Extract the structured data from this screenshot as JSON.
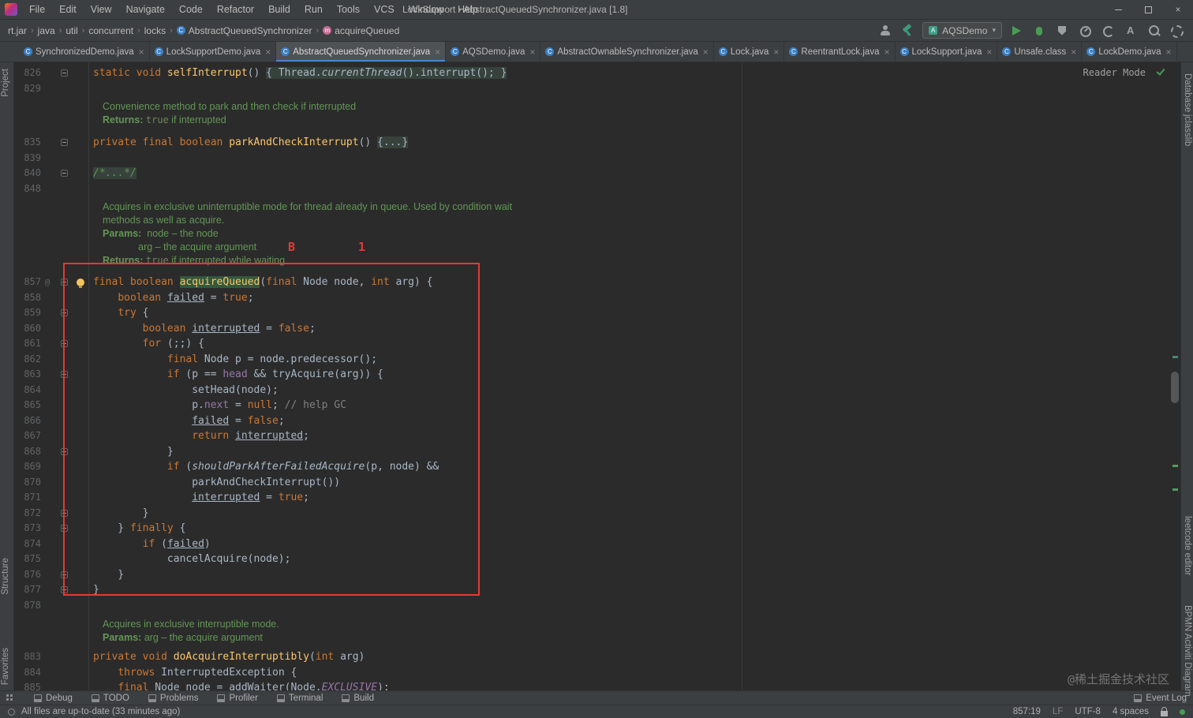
{
  "titlebar": {
    "menus": [
      "File",
      "Edit",
      "View",
      "Navigate",
      "Code",
      "Refactor",
      "Build",
      "Run",
      "Tools",
      "VCS",
      "Window",
      "Help"
    ],
    "title": "LockSupport - AbstractQueuedSynchronizer.java [1.8]"
  },
  "navbar": {
    "breadcrumbs": [
      {
        "label": "rt.jar"
      },
      {
        "label": "java"
      },
      {
        "label": "util"
      },
      {
        "label": "concurrent"
      },
      {
        "label": "locks"
      },
      {
        "label": "AbstractQueuedSynchronizer",
        "icon": "class"
      },
      {
        "label": "acquireQueued",
        "icon": "method"
      }
    ],
    "run_config": "AQSDemo",
    "toolbar_icons_left": [
      "user",
      "hammer"
    ],
    "toolbar_icons_right": [
      "run",
      "debug",
      "coverage",
      "profiler",
      "rerun",
      "translate",
      "search",
      "settings"
    ]
  },
  "tabs": {
    "active_index": 2,
    "items": [
      {
        "label": "SynchronizedDemo.java"
      },
      {
        "label": "LockSupportDemo.java"
      },
      {
        "label": "AbstractQueuedSynchronizer.java"
      },
      {
        "label": "AQSDemo.java"
      },
      {
        "label": "AbstractOwnableSynchronizer.java"
      },
      {
        "label": "Lock.java"
      },
      {
        "label": "ReentrantLock.java"
      },
      {
        "label": "LockSupport.java"
      },
      {
        "label": "Unsafe.class"
      },
      {
        "label": "LockDemo.java"
      }
    ]
  },
  "left_stripe": [
    "Project",
    "Structure",
    "Favorites"
  ],
  "right_stripe": [
    "Database",
    "jclasslib",
    "leetcode editor",
    "BPMN Activiti Diagram"
  ],
  "editor": {
    "reader_mode": "Reader Mode",
    "lines": [
      {
        "n": "826",
        "f": "m",
        "t": [
          [
            "kw",
            "static void "
          ],
          [
            "mth",
            "selfInterrupt"
          ],
          [
            "pln",
            "() "
          ],
          [
            "fold",
            "{ Thread."
          ],
          [
            "foldit",
            "currentThread"
          ],
          [
            "fold",
            "().interrupt(); }"
          ]
        ]
      },
      {
        "n": "829",
        "t": []
      },
      {
        "s": 5
      },
      {
        "d": 1,
        "t": [
          [
            "doc",
            "Convenience method to park and then check if interrupted"
          ]
        ]
      },
      {
        "d": 1,
        "t": [
          [
            "doctag",
            "Returns: "
          ],
          [
            "doccode",
            "true"
          ],
          [
            "doc",
            " if interrupted"
          ]
        ]
      },
      {
        "s": 10
      },
      {
        "n": "835",
        "f": "m",
        "t": [
          [
            "kw",
            "private final boolean "
          ],
          [
            "mth",
            "parkAndCheckInterrupt"
          ],
          [
            "pln",
            "() "
          ],
          [
            "fold",
            "{...}"
          ]
        ]
      },
      {
        "n": "839",
        "t": []
      },
      {
        "n": "840",
        "f": "m",
        "t": [
          [
            "folddoc",
            "/*...*/"
          ]
        ]
      },
      {
        "n": "848",
        "t": []
      },
      {
        "s": 5
      },
      {
        "d": 1,
        "t": [
          [
            "doc",
            "Acquires in exclusive uninterruptible mode for thread already in queue. Used by condition wait"
          ]
        ]
      },
      {
        "d": 1,
        "t": [
          [
            "doc",
            "methods as well as acquire."
          ]
        ]
      },
      {
        "d": 1,
        "t": [
          [
            "doctag",
            "Params:"
          ],
          [
            "doc",
            "  node – the node"
          ]
        ]
      },
      {
        "d": 1,
        "t": [
          [
            "doc",
            "             arg – the acquire argument"
          ]
        ]
      },
      {
        "d": 1,
        "t": [
          [
            "doctag",
            "Returns: "
          ],
          [
            "doccode",
            "true"
          ],
          [
            "doc",
            " if interrupted while waiting"
          ]
        ]
      },
      {
        "s": 9
      },
      {
        "n": "857",
        "g": "@",
        "b": 1,
        "f": "m",
        "t": [
          [
            "kw",
            "final boolean "
          ],
          [
            "mthhl",
            "acquireQueued"
          ],
          [
            "pln",
            "("
          ],
          [
            "kw",
            "final "
          ],
          [
            "pln",
            "Node node, "
          ],
          [
            "kw",
            "int "
          ],
          [
            "pln",
            "arg) {"
          ]
        ]
      },
      {
        "n": "858",
        "t": [
          [
            "pln",
            "    "
          ],
          [
            "kw",
            "boolean "
          ],
          [
            "u",
            "failed"
          ],
          [
            "pln",
            " = "
          ],
          [
            "kw",
            "true"
          ],
          [
            "pln",
            ";"
          ]
        ]
      },
      {
        "n": "859",
        "f": "m",
        "t": [
          [
            "pln",
            "    "
          ],
          [
            "kw",
            "try"
          ],
          [
            "pln",
            " {"
          ]
        ]
      },
      {
        "n": "860",
        "t": [
          [
            "pln",
            "        "
          ],
          [
            "kw",
            "boolean "
          ],
          [
            "u",
            "interrupted"
          ],
          [
            "pln",
            " = "
          ],
          [
            "kw",
            "false"
          ],
          [
            "pln",
            ";"
          ]
        ]
      },
      {
        "n": "861",
        "f": "m",
        "t": [
          [
            "pln",
            "        "
          ],
          [
            "kw",
            "for"
          ],
          [
            "pln",
            " (;;) {"
          ]
        ]
      },
      {
        "n": "862",
        "t": [
          [
            "pln",
            "            "
          ],
          [
            "kw",
            "final "
          ],
          [
            "pln",
            "Node p = node.predecessor();"
          ]
        ]
      },
      {
        "n": "863",
        "f": "m",
        "t": [
          [
            "pln",
            "            "
          ],
          [
            "kw",
            "if"
          ],
          [
            "pln",
            " (p == "
          ],
          [
            "fld",
            "head"
          ],
          [
            "pln",
            " && tryAcquire(arg)) {"
          ]
        ]
      },
      {
        "n": "864",
        "t": [
          [
            "pln",
            "                setHead(node);"
          ]
        ]
      },
      {
        "n": "865",
        "t": [
          [
            "pln",
            "                p."
          ],
          [
            "fld",
            "next"
          ],
          [
            "pln",
            " = "
          ],
          [
            "kw",
            "null"
          ],
          [
            "pln",
            "; "
          ],
          [
            "cmt",
            "// help GC"
          ]
        ]
      },
      {
        "n": "866",
        "t": [
          [
            "pln",
            "                "
          ],
          [
            "u",
            "failed"
          ],
          [
            "pln",
            " = "
          ],
          [
            "kw",
            "false"
          ],
          [
            "pln",
            ";"
          ]
        ]
      },
      {
        "n": "867",
        "t": [
          [
            "pln",
            "                "
          ],
          [
            "kw",
            "return "
          ],
          [
            "u",
            "interrupted"
          ],
          [
            "pln",
            ";"
          ]
        ]
      },
      {
        "n": "868",
        "f": "e",
        "t": [
          [
            "pln",
            "            }"
          ]
        ]
      },
      {
        "n": "869",
        "t": [
          [
            "pln",
            "            "
          ],
          [
            "kw",
            "if"
          ],
          [
            "pln",
            " ("
          ],
          [
            "it",
            "shouldParkAfterFailedAcquire"
          ],
          [
            "pln",
            "(p, node) &&"
          ]
        ]
      },
      {
        "n": "870",
        "t": [
          [
            "pln",
            "                parkAndCheckInterrupt())"
          ]
        ]
      },
      {
        "n": "871",
        "t": [
          [
            "pln",
            "                "
          ],
          [
            "u",
            "interrupted"
          ],
          [
            "pln",
            " = "
          ],
          [
            "kw",
            "true"
          ],
          [
            "pln",
            ";"
          ]
        ]
      },
      {
        "n": "872",
        "f": "e",
        "t": [
          [
            "pln",
            "        }"
          ]
        ]
      },
      {
        "n": "873",
        "f": "m",
        "t": [
          [
            "pln",
            "    } "
          ],
          [
            "kw",
            "finally"
          ],
          [
            "pln",
            " {"
          ]
        ]
      },
      {
        "n": "874",
        "t": [
          [
            "pln",
            "        "
          ],
          [
            "kw",
            "if"
          ],
          [
            "pln",
            " ("
          ],
          [
            "u",
            "failed"
          ],
          [
            "pln",
            ")"
          ]
        ]
      },
      {
        "n": "875",
        "t": [
          [
            "pln",
            "            cancelAcquire(node);"
          ]
        ]
      },
      {
        "n": "876",
        "f": "e",
        "t": [
          [
            "pln",
            "    }"
          ]
        ]
      },
      {
        "n": "877",
        "f": "e",
        "t": [
          [
            "pln",
            "}"
          ]
        ]
      },
      {
        "n": "878",
        "t": []
      },
      {
        "s": 6
      },
      {
        "d": 1,
        "t": [
          [
            "doc",
            "Acquires in exclusive interruptible mode."
          ]
        ]
      },
      {
        "d": 1,
        "t": [
          [
            "doctag",
            "Params:"
          ],
          [
            "doc",
            " arg – the acquire argument"
          ]
        ]
      },
      {
        "s": 6
      },
      {
        "n": "883",
        "t": [
          [
            "kw",
            "private void "
          ],
          [
            "mth",
            "doAcquireInterruptibly"
          ],
          [
            "pln",
            "("
          ],
          [
            "kw",
            "int "
          ],
          [
            "pln",
            "arg)"
          ]
        ]
      },
      {
        "n": "884",
        "t": [
          [
            "pln",
            "    "
          ],
          [
            "kw",
            "throws "
          ],
          [
            "pln",
            "InterruptedException {"
          ]
        ]
      },
      {
        "n": "885",
        "t": [
          [
            "pln",
            "    "
          ],
          [
            "kw",
            "final "
          ],
          [
            "pln",
            "Node node = addWaiter(Node."
          ],
          [
            "fldit",
            "EXCLUSIVE"
          ],
          [
            "pln",
            ");"
          ]
        ]
      }
    ]
  },
  "annotations": {
    "label_b": "B",
    "label_1": "1"
  },
  "bottom": {
    "tool_windows": [
      "Debug",
      "TODO",
      "Problems",
      "Profiler",
      "Terminal",
      "Build"
    ],
    "event_log": "Event Log"
  },
  "status_bar": {
    "message": "All files are up-to-date (33 minutes ago)",
    "caret": "857:19",
    "line_ending": "LF",
    "encoding": "UTF-8",
    "indent": "4 spaces"
  },
  "watermark": "@稀土掘金技术社区"
}
